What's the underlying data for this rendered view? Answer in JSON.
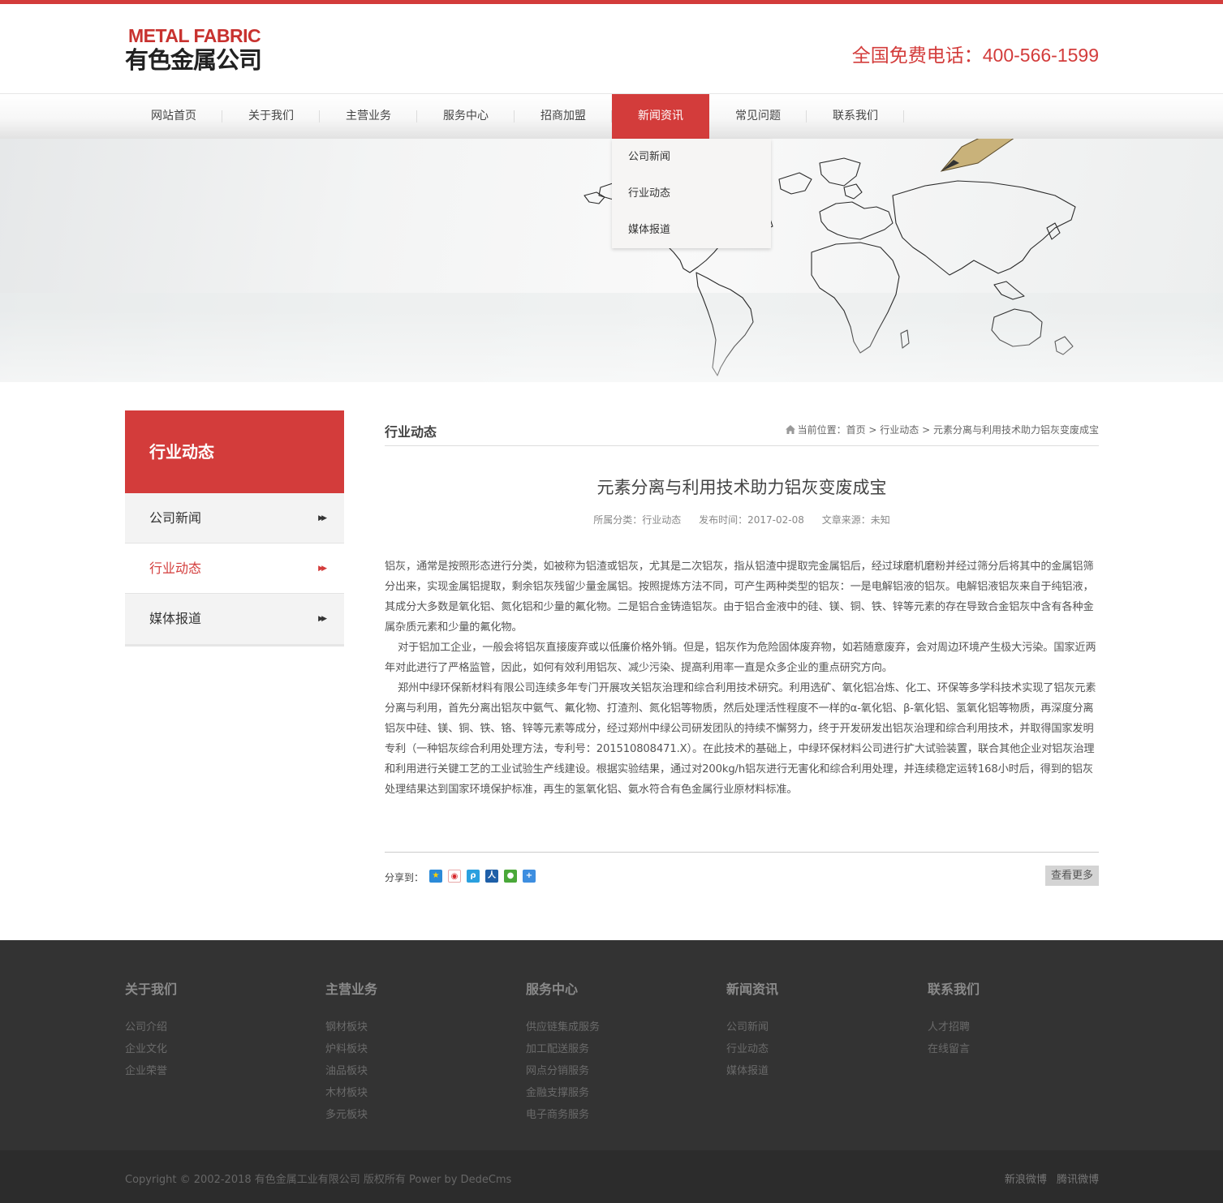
{
  "colors": {
    "accent": "#d33c3b",
    "footer_bg": "#333333",
    "bottom_bg": "#2c2c2c"
  },
  "header": {
    "logo_en": "METAL FABRIC",
    "logo_cn": "有色金属公司",
    "hotline_label": "全国免费电话：",
    "hotline_number": "400-566-1599"
  },
  "nav": {
    "items": [
      {
        "label": "网站首页"
      },
      {
        "label": "关于我们"
      },
      {
        "label": "主营业务"
      },
      {
        "label": "服务中心"
      },
      {
        "label": "招商加盟"
      },
      {
        "label": "新闻资讯",
        "active": true
      },
      {
        "label": "常见问题"
      },
      {
        "label": "联系我们"
      }
    ],
    "dropdown": [
      "公司新闻",
      "行业动态",
      "媒体报道"
    ]
  },
  "sidebar": {
    "title": "行业动态",
    "items": [
      {
        "label": "公司新闻"
      },
      {
        "label": "行业动态",
        "active": true
      },
      {
        "label": "媒体报道"
      }
    ],
    "arrow_icon": "double-chevron-right-icon"
  },
  "main": {
    "section_title": "行业动态",
    "breadcrumb": {
      "prefix": "当前位置：",
      "home": "首页",
      "sep": " > ",
      "category": "行业动态",
      "current": "元素分离与利用技术助力铝灰变废成宝"
    },
    "article": {
      "title": "元素分离与利用技术助力铝灰变废成宝",
      "meta_category": "所属分类：行业动态",
      "meta_date": "发布时间：2017-02-08",
      "meta_source": "文章来源：未知",
      "paragraphs": [
        "铝灰，通常是按照形态进行分类，如被称为铝渣或铝灰，尤其是二次铝灰，指从铝渣中提取完金属铝后，经过球磨机磨粉并经过筛分后将其中的金属铝筛分出来，实现金属铝提取，剩余铝灰残留少量金属铝。按照提炼方法不同，可产生两种类型的铝灰：一是电解铝液的铝灰。电解铝液铝灰来自于纯铝液，其成分大多数是氧化铝、氮化铝和少量的氟化物。二是铝合金铸造铝灰。由于铝合金液中的硅、镁、铜、铁、锌等元素的存在导致合金铝灰中含有各种金属杂质元素和少量的氟化物。",
        "对于铝加工企业，一般会将铝灰直接废弃或以低廉价格外销。但是，铝灰作为危险固体废弃物，如若随意废弃，会对周边环境产生极大污染。国家近两年对此进行了严格监管，因此，如何有效利用铝灰、减少污染、提高利用率一直是众多企业的重点研究方向。",
        "郑州中绿环保新材料有限公司连续多年专门开展攻关铝灰治理和综合利用技术研究。利用选矿、氧化铝冶炼、化工、环保等多学科技术实现了铝灰元素分离与利用，首先分离出铝灰中氨气、氟化物、打渣剂、氮化铝等物质，然后处理活性程度不一样的α-氧化铝、β-氧化铝、氢氧化铝等物质，再深度分离铝灰中硅、镁、铜、铁、铬、锌等元素等成分，经过郑州中绿公司研发团队的持续不懈努力，终于开发研发出铝灰治理和综合利用技术，并取得国家发明专利（一种铝灰综合利用处理方法，专利号：201510808471.X）。在此技术的基础上，中绿环保材料公司进行扩大试验装置，联合其他企业对铝灰治理和利用进行关键工艺的工业试验生产线建设。根据实验结果，通过对200kg/h铝灰进行无害化和综合利用处理，并连续稳定运转168小时后，得到的铝灰处理结果达到国家环境保护标准，再生的氢氧化铝、氨水符合有色金属行业原材料标准。"
      ]
    },
    "share_label": "分享到：",
    "share_icons": [
      "qzone-icon",
      "weibo-icon",
      "tencent-weibo-icon",
      "renren-icon",
      "wechat-icon",
      "more-share-icon"
    ],
    "more_label": "查看更多"
  },
  "footer": {
    "columns": [
      {
        "title": "关于我们",
        "links": [
          "公司介绍",
          "企业文化",
          "企业荣誉"
        ]
      },
      {
        "title": "主营业务",
        "links": [
          "钢材板块",
          "炉料板块",
          "油品板块",
          "木材板块",
          "多元板块"
        ]
      },
      {
        "title": "服务中心",
        "links": [
          "供应链集成服务",
          "加工配送服务",
          "网点分销服务",
          "金融支撑服务",
          "电子商务服务"
        ]
      },
      {
        "title": "新闻资讯",
        "links": [
          "公司新闻",
          "行业动态",
          "媒体报道"
        ]
      },
      {
        "title": "联系我们",
        "links": [
          "人才招聘",
          "在线留言"
        ]
      }
    ],
    "copyright": "Copyright © 2002-2018 有色金属工业有限公司 版权所有 Power by DedeCms",
    "social": [
      "新浪微博",
      "腾讯微博"
    ]
  }
}
